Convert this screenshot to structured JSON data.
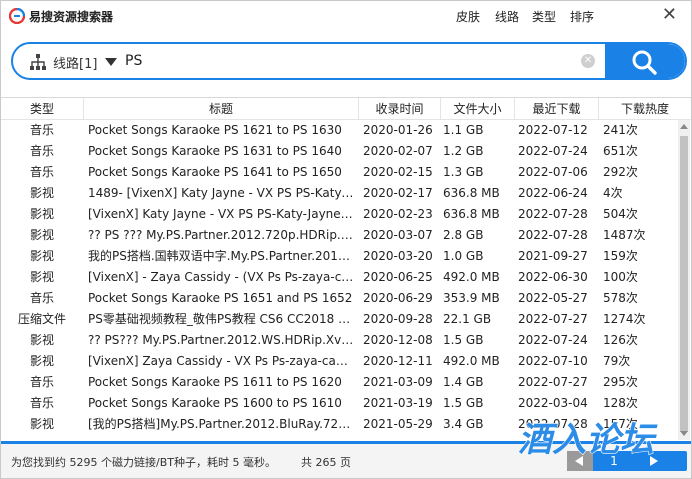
{
  "app": {
    "title": "易搜资源搜索器"
  },
  "menu": {
    "skin": "皮肤",
    "route": "线路",
    "type": "类型",
    "sort": "排序",
    "close": "✕"
  },
  "search": {
    "route_label": "线路[1]",
    "query": "PS",
    "clear": "✕"
  },
  "table": {
    "columns": [
      "类型",
      "标题",
      "收录时间",
      "文件大小",
      "最近下载",
      "下载热度"
    ],
    "rows": [
      [
        "音乐",
        "Pocket Songs Karaoke PS 1621 to PS 1630",
        "2020-01-26",
        "1.1 GB",
        "2022-07-12",
        "241次"
      ],
      [
        "音乐",
        "Pocket Songs Karaoke PS 1631 to PS 1640",
        "2020-02-07",
        "1.2 GB",
        "2022-07-24",
        "651次"
      ],
      [
        "音乐",
        "Pocket Songs Karaoke PS 1641 to PS 1650",
        "2020-02-15",
        "1.3 GB",
        "2022-07-06",
        "292次"
      ],
      [
        "影视",
        "1489- [VixenX] Katy Jayne - VX PS PS-Katy-Jayne",
        "2020-02-17",
        "636.8 MB",
        "2022-06-24",
        "4次"
      ],
      [
        "影视",
        "[VixenX] Katy Jayne - VX PS PS-Katy-Jayne (...",
        "2020-02-23",
        "636.8 MB",
        "2022-07-28",
        "504次"
      ],
      [
        "影视",
        "?? PS ??? My.PS.Partner.2012.720p.HDRip.H...",
        "2020-03-07",
        "2.8 GB",
        "2022-07-28",
        "1487次"
      ],
      [
        "影视",
        "我的PS搭档.国韩双语中字.My.PS.Partner.2012...",
        "2020-03-20",
        "1.0 GB",
        "2021-09-27",
        "159次"
      ],
      [
        "影视",
        "[VixenX] - Zaya Cassidy - (VX Ps Ps-zaya-ca...",
        "2020-06-25",
        "492.0 MB",
        "2022-06-30",
        "100次"
      ],
      [
        "音乐",
        "Pocket Songs Karaoke PS 1651 and PS 1652",
        "2020-06-29",
        "353.9 MB",
        "2022-05-27",
        "578次"
      ],
      [
        "压缩文件",
        "PS零基础视频教程_敬伟PS教程 CS6 CC2018 p...",
        "2020-09-28",
        "22.1 GB",
        "2022-07-27",
        "1274次"
      ],
      [
        "影视",
        "?? PS??? My.PS.Partner.2012.WS.HDRip.XviD...",
        "2020-12-08",
        "1.5 GB",
        "2022-07-24",
        "126次"
      ],
      [
        "影视",
        "[VixenX] Zaya Cassidy - VX Ps Ps-zaya-cassi...",
        "2020-12-11",
        "492.0 MB",
        "2022-07-10",
        "79次"
      ],
      [
        "音乐",
        "Pocket Songs Karaoke PS 1611 to PS 1620",
        "2021-03-09",
        "1.4 GB",
        "2022-07-27",
        "295次"
      ],
      [
        "音乐",
        "Pocket Songs Karaoke PS 1600 to PS 1610",
        "2021-03-19",
        "1.5 GB",
        "2022-03-04",
        "128次"
      ],
      [
        "影视",
        "[我的PS搭档]My.PS.Partner.2012.BluRay.720...",
        "2021-05-29",
        "3.4 GB",
        "2022-07-28",
        "157次"
      ]
    ]
  },
  "status": {
    "text": "为您找到约 5295 个磁力链接/BT种子，耗时 5 毫秒。",
    "total_pages": "共 265 页",
    "current_page": "1"
  },
  "watermark": {
    "text": "酒入论坛"
  },
  "colors": {
    "accent": "#1a82e6",
    "watermark": "#1a82e6"
  }
}
